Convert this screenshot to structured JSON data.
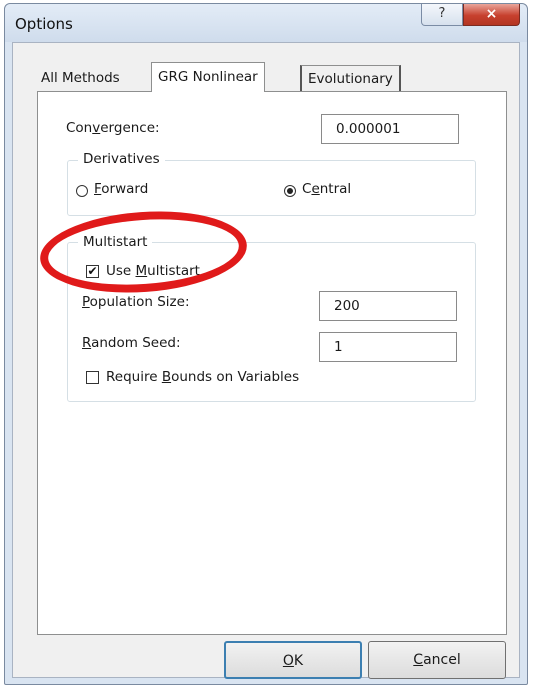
{
  "window": {
    "title": "Options",
    "help_label": "?",
    "close_label": "×"
  },
  "tabs": [
    {
      "label": "All Methods",
      "selected": false
    },
    {
      "label": "GRG Nonlinear",
      "selected": true
    },
    {
      "label": "Evolutionary",
      "selected": false
    }
  ],
  "convergence": {
    "label_pre": "Con",
    "label_accel": "v",
    "label_post": "ergence:",
    "value": "0.000001"
  },
  "derivatives": {
    "title": "Derivatives",
    "forward": {
      "label_pre": "",
      "label_accel": "F",
      "label_post": "orward",
      "selected": false
    },
    "central": {
      "label_pre": "C",
      "label_accel": "e",
      "label_post": "ntral",
      "selected": true
    }
  },
  "multistart": {
    "title": "Multistart",
    "use_multistart": {
      "label_pre": "Use ",
      "label_accel": "M",
      "label_post": "ultistart",
      "checked": true
    },
    "population_size": {
      "label_pre": "",
      "label_accel": "P",
      "label_post": "opulation Size:",
      "value": "200"
    },
    "random_seed": {
      "label_pre": "",
      "label_accel": "R",
      "label_post": "andom Seed:",
      "value": "1"
    },
    "require_bounds": {
      "label_pre": "Require ",
      "label_accel": "B",
      "label_post": "ounds on Variables",
      "checked": false
    }
  },
  "buttons": {
    "ok": {
      "label_pre": "",
      "label_accel": "O",
      "label_post": "K"
    },
    "cancel": {
      "label_pre": "",
      "label_accel": "C",
      "label_post": "ancel"
    }
  },
  "colors": {
    "annotation": "#e01a1a"
  }
}
